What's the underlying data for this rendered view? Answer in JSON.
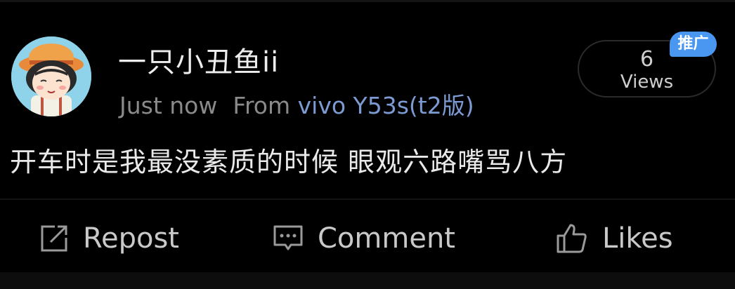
{
  "post": {
    "username": "一只小丑鱼ii",
    "time": "Just now",
    "from_prefix": "From",
    "device": "vivo Y53s(t2版)",
    "views_count": "6",
    "views_label": "Views",
    "promo_badge": "推广",
    "text": "开车时是我最没素质的时候  眼观六路嘴骂八方"
  },
  "actions": {
    "repost_label": "Repost",
    "comment_label": "Comment",
    "likes_label": "Likes"
  },
  "colors": {
    "background": "#000000",
    "device_link": "#7d9bd3",
    "promo_badge": "#4a97f2",
    "text_primary": "#e9e9e9",
    "text_secondary": "#8a8a8a"
  },
  "icons": {
    "repost": "repost-icon",
    "comment": "comment-icon",
    "likes": "thumbs-up-icon"
  }
}
